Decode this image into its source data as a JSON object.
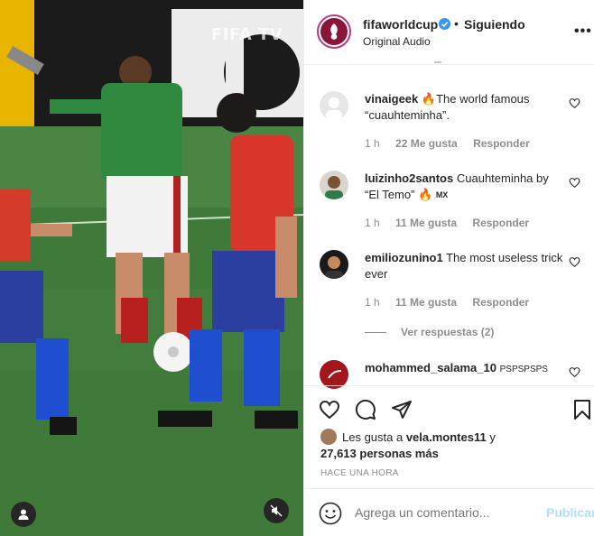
{
  "media": {
    "watermark": "FIFA TV"
  },
  "post": {
    "username": "fifaworldcup",
    "dot": "•",
    "follow_label": "Siguiendo",
    "audio_label": "Original Audio",
    "more_label": "•••"
  },
  "comments": [
    {
      "username": "vinaigeek",
      "text": "The world famous “cuauhteminha”.",
      "time": "1 h",
      "likes": "22 Me gusta",
      "reply": "Responder"
    },
    {
      "username": "luizinho2santos",
      "text": "Cuauhteminha by “El Temo” ",
      "flag": "MX",
      "time": "1 h",
      "likes": "11 Me gusta",
      "reply": "Responder"
    },
    {
      "username": "emiliozunino1",
      "text": "The most useless trick ever",
      "time": "1 h",
      "likes": "11 Me gusta",
      "reply": "Responder"
    },
    {
      "username": "mohammed_salama_10",
      "text": "PSPSPSPS"
    }
  ],
  "view_replies": "Ver respuestas (2)",
  "likes": {
    "prefix": "Les gusta a ",
    "user": "vela.montes11",
    "suffix": " y",
    "count": "27,613 personas más"
  },
  "timestamp": "HACE UNA HORA",
  "composer": {
    "placeholder": "Agrega un comentario...",
    "post_label": "Publicar"
  },
  "colors": {
    "brand_maroon": "#8a1538",
    "verified_blue": "#3897f0",
    "publish_disabled": "#b2dffc",
    "pitch_green": "#3f7a3a"
  }
}
